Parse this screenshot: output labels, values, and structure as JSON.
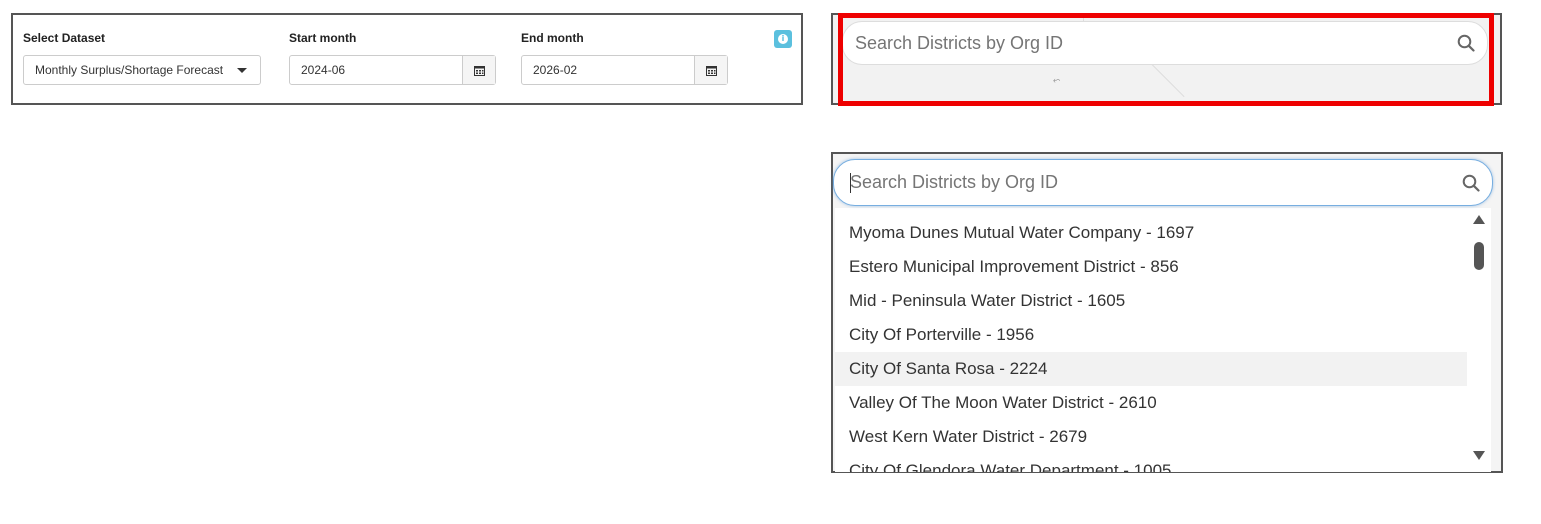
{
  "filters": {
    "dataset": {
      "label": "Select Dataset",
      "value": "Monthly Surplus/Shortage Forecast"
    },
    "start": {
      "label": "Start month",
      "value": "2024-06"
    },
    "end": {
      "label": "End month",
      "value": "2026-02"
    },
    "info_icon": "info-icon"
  },
  "search_top": {
    "placeholder": "Search Districts by Org ID",
    "icon": "search-icon",
    "highlight_color": "#ee0000"
  },
  "search_bottom": {
    "placeholder": "Search Districts by Org ID",
    "icon": "search-icon",
    "focus_color": "#77aee0",
    "results": [
      "Myoma Dunes Mutual Water Company - 1697",
      "Estero Municipal Improvement District - 856",
      "Mid - Peninsula Water District - 1605",
      "City Of Porterville - 1956",
      "City Of Santa Rosa - 2224",
      "Valley Of The Moon Water District - 2610",
      "West Kern Water District - 2679",
      "City Of Glendora Water Department - 1005"
    ],
    "highlighted_result": "City Of Santa Rosa - 2224"
  }
}
